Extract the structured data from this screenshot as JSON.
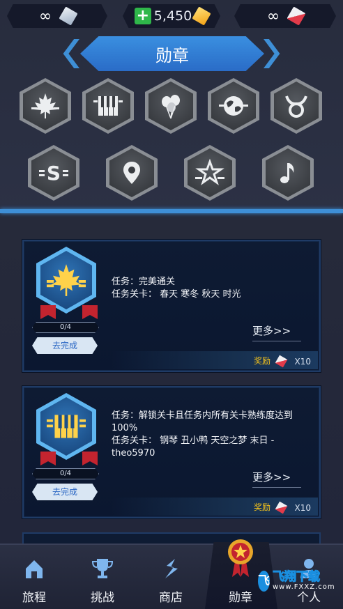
{
  "currency": {
    "left_value": "∞",
    "gold_amount": "5,450",
    "right_value": "∞"
  },
  "title": "勋章",
  "medal_icons": [
    "maple-leaf-icon",
    "piano-icon",
    "balloons-icon",
    "globe-icon",
    "taurus-icon",
    "s-letter-icon",
    "location-pin-icon",
    "star-icon",
    "music-note-icon"
  ],
  "cards": [
    {
      "progress": "0/4",
      "progress_fraction": 0,
      "go_label": "去完成",
      "task_line": "任务：完美通关",
      "levels_line": "任务关卡： 春天 寒冬 秋天 时光",
      "more_label": "更多>>",
      "reward_label": "奖励",
      "reward_count": "X10"
    },
    {
      "progress": "0/4",
      "progress_fraction": 0,
      "go_label": "去完成",
      "task_line": "任务：解锁关卡且任务内所有关卡熟练度达到100%",
      "levels_line": "任务关卡： 钢琴 丑小鸭 天空之梦 末日 - theo5970",
      "more_label": "更多>>",
      "reward_label": "奖励",
      "reward_count": "X10"
    }
  ],
  "nav": [
    {
      "label": "旅程",
      "icon": "house-icon"
    },
    {
      "label": "挑战",
      "icon": "trophy-icon"
    },
    {
      "label": "商店",
      "icon": "shop-icon"
    },
    {
      "label": "勋章",
      "icon": "medal-icon"
    },
    {
      "label": "个人",
      "icon": "profile-icon"
    }
  ],
  "watermark": {
    "logo": "飞",
    "text": "飞翔下载",
    "url": "www.FXXZ.com"
  },
  "colors": {
    "accent": "#3e8fd6",
    "reward": "#f3c21c",
    "plus": "#2fb74a",
    "ribbon": "#c3242f"
  }
}
